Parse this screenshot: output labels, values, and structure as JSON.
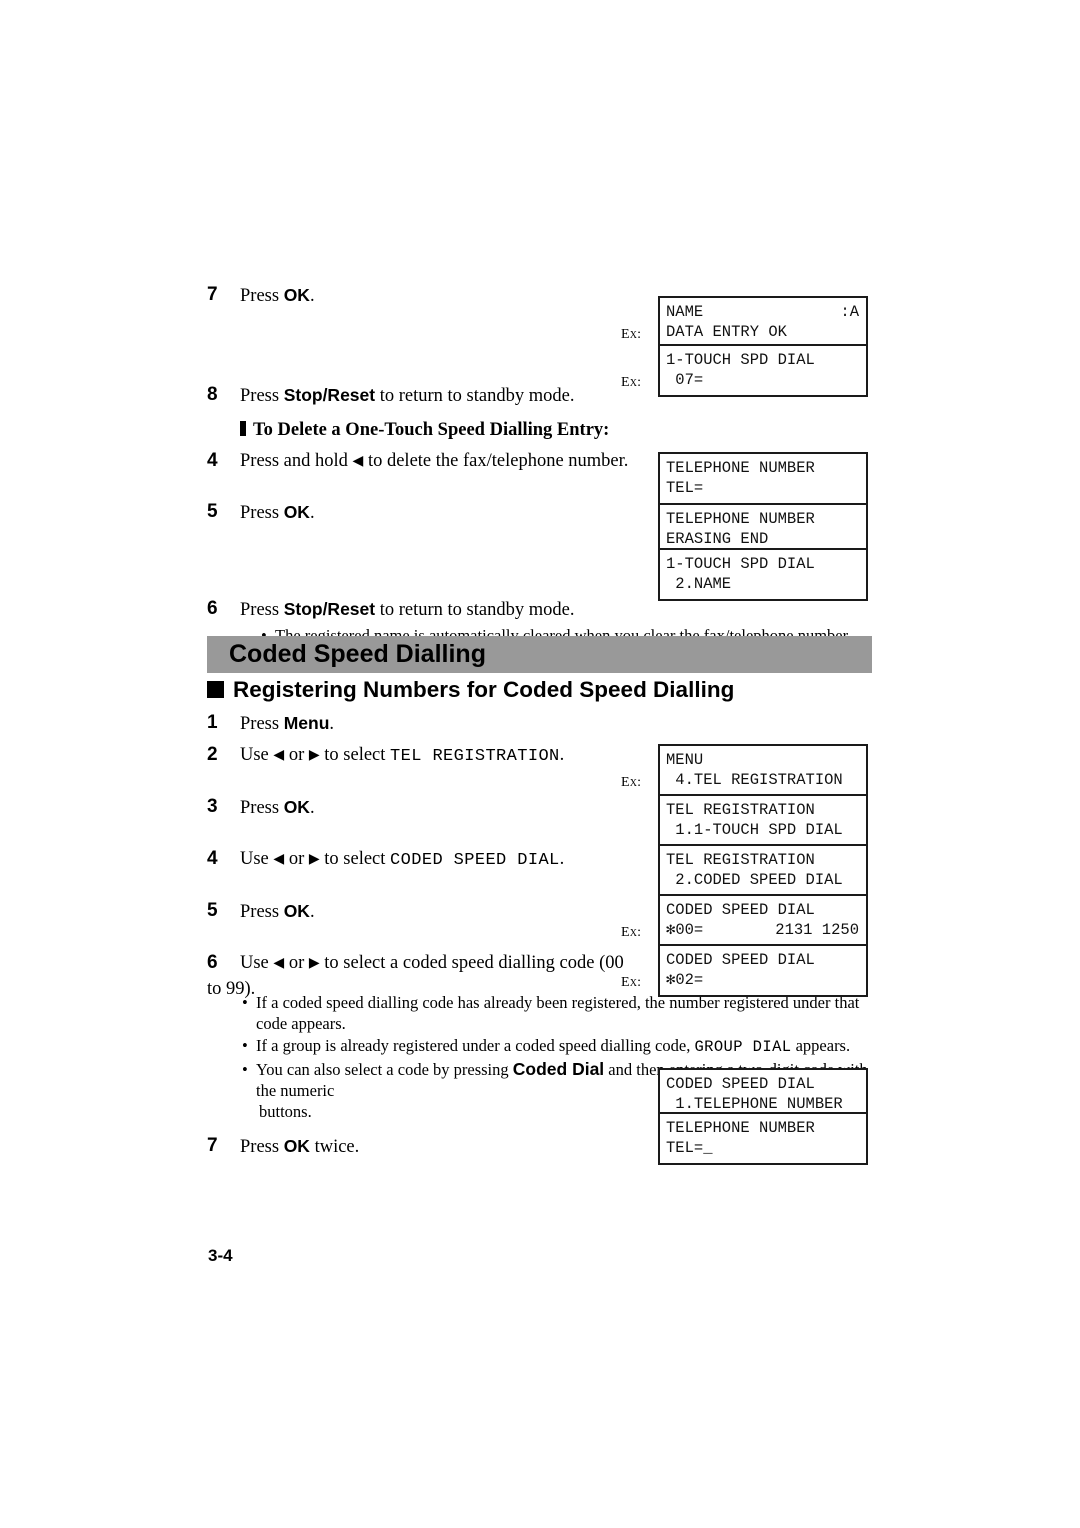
{
  "page": {
    "number": "3-4",
    "band_color": "#999999"
  },
  "top_section": {
    "steps": [
      {
        "num": "7",
        "pre": "Press ",
        "bold": "OK",
        "post": "."
      },
      {
        "num": "8",
        "pre": "Press ",
        "bold": "Stop/Reset",
        "post": " to return to standby mode."
      }
    ],
    "subheading": "To Delete a One-Touch Speed Dialling Entry:",
    "delete_steps": [
      {
        "num": "4",
        "pre": "Press and hold ",
        "arrow": "◀",
        "post": " to delete the fax/telephone number."
      },
      {
        "num": "5",
        "pre": "Press ",
        "bold": "OK",
        "post": "."
      },
      {
        "num": "6",
        "pre": "Press ",
        "bold": "Stop/Reset",
        "post": " to return to standby mode."
      }
    ],
    "note": "The registered name is automatically cleared when you clear the fax/telephone number.",
    "lcds": [
      {
        "ex": "Ex:",
        "line1_left": "NAME",
        "line1_right": ":A",
        "line2": "DATA ENTRY OK"
      },
      {
        "ex": "Ex:",
        "line1": "1-TOUCH SPD DIAL",
        "line2": " 07="
      },
      {
        "ex": "",
        "line1": "TELEPHONE NUMBER",
        "line2": "TEL="
      },
      {
        "ex": "",
        "line1": "TELEPHONE NUMBER",
        "line2": "ERASING END"
      },
      {
        "ex": "",
        "line1": "1-TOUCH SPD DIAL",
        "line2": " 2.NAME"
      }
    ]
  },
  "section": {
    "band_title": "Coded Speed Dialling",
    "heading": "Registering Numbers for Coded Speed Dialling"
  },
  "bottom_section": {
    "steps": [
      {
        "num": "1",
        "pre": "Press ",
        "bold": "Menu",
        "post": "."
      },
      {
        "num": "2",
        "pre": "Use ",
        "arrow_l": "◀",
        "mid": " or ",
        "arrow_r": "▶",
        "post": " to select ",
        "mono": "TEL REGISTRATION",
        "tail": "."
      },
      {
        "num": "3",
        "pre": "Press ",
        "bold": "OK",
        "post": "."
      },
      {
        "num": "4",
        "pre": "Use ",
        "arrow_l": "◀",
        "mid": " or ",
        "arrow_r": "▶",
        "post": " to select ",
        "mono": "CODED SPEED DIAL",
        "tail": "."
      },
      {
        "num": "5",
        "pre": "Press ",
        "bold": "OK",
        "post": "."
      },
      {
        "num": "6",
        "pre": "Use ",
        "arrow_l": "◀",
        "mid": " or ",
        "arrow_r": "▶",
        "post": " to select a coded speed dialling code (00 to 99)."
      },
      {
        "num": "7",
        "pre": "Press ",
        "bold": "OK",
        "post": " twice."
      }
    ],
    "notes": [
      {
        "text": "If a coded speed dialling code has already been registered, the number registered under that code appears."
      },
      {
        "pre": "If a group is already registered under a coded speed dialling code, ",
        "mono": "GROUP DIAL",
        "post": " appears."
      },
      {
        "pre": "You can also select a code by pressing ",
        "bold": "Coded Dial",
        "post": " and then entering a two-digit code with the numeric",
        "cont": "buttons."
      }
    ],
    "lcds": [
      {
        "ex": "Ex:",
        "line1": "MENU",
        "line2": " 4.TEL REGISTRATION"
      },
      {
        "ex": "",
        "line1": "TEL REGISTRATION",
        "line2": " 1.1-TOUCH SPD DIAL"
      },
      {
        "ex": "",
        "line1": "TEL REGISTRATION",
        "line2": " 2.CODED SPEED DIAL"
      },
      {
        "ex": "Ex:",
        "line1": "CODED SPEED DIAL",
        "line2_left": "✻00=",
        "line2_right": "2131 1250"
      },
      {
        "ex": "Ex:",
        "line1": "CODED SPEED DIAL",
        "line2": "✻02="
      },
      {
        "ex": "",
        "line1": "CODED SPEED DIAL",
        "line2": " 1.TELEPHONE NUMBER"
      },
      {
        "ex": "",
        "line1": "TELEPHONE NUMBER",
        "line2": "TEL=_"
      }
    ]
  }
}
